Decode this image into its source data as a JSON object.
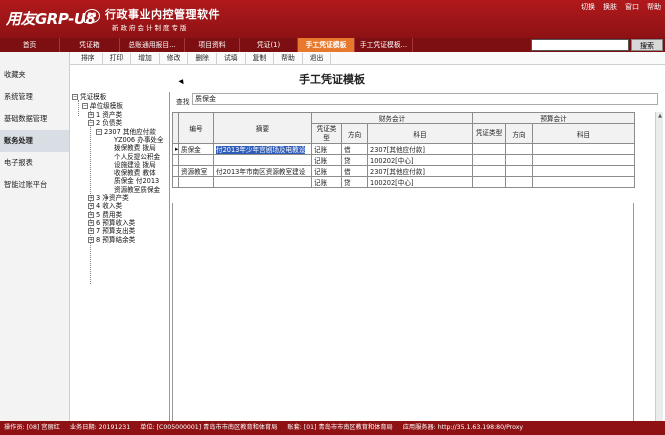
{
  "header": {
    "logo_text": "用友GRP-U8",
    "logo_badge": "R8",
    "app_title": "行政事业内控管理软件",
    "app_subtitle": "新政府会计制度专版",
    "links": [
      "切换",
      "换肤",
      "窗口",
      "帮助"
    ]
  },
  "tabs": [
    {
      "label": "首页",
      "active": false
    },
    {
      "label": "凭证箱",
      "active": false
    },
    {
      "label": "总账通用报目...",
      "active": false
    },
    {
      "label": "项目资料",
      "active": false
    },
    {
      "label": "凭证(1)",
      "active": false
    },
    {
      "label": "手工凭证模板",
      "active": true
    },
    {
      "label": "手工凭证模板...",
      "active": false
    }
  ],
  "search": {
    "button_label": "搜索",
    "value": ""
  },
  "sidebar": {
    "items": [
      {
        "label": "收藏夹",
        "active": false
      },
      {
        "label": "系统管理",
        "active": false
      },
      {
        "label": "基础数据管理",
        "active": false
      },
      {
        "label": "账务处理",
        "active": true
      },
      {
        "label": "电子报表",
        "active": false
      },
      {
        "label": "智能过账平台",
        "active": false
      }
    ]
  },
  "toolbar": [
    "排序",
    "打印",
    "增加",
    "修改",
    "删除",
    "试填",
    "复制",
    "帮助",
    "退出"
  ],
  "page_title": "手工凭证模板",
  "tree": {
    "root": "凭证模板",
    "unit": "单位级模板",
    "nodes": [
      {
        "text": "1 资产类",
        "level": 2,
        "expander": "+"
      },
      {
        "text": "2 负债类",
        "level": 2,
        "expander": "−"
      },
      {
        "text": "2307 其他应付款",
        "level": 3,
        "expander": "−"
      },
      {
        "text": "YZ006 办事处全",
        "level": 4,
        "expander": ""
      },
      {
        "text": "拨保教费 拨局",
        "level": 4,
        "expander": ""
      },
      {
        "text": "个人反提公积金",
        "level": 4,
        "expander": ""
      },
      {
        "text": "设施建设 拨局",
        "level": 4,
        "expander": ""
      },
      {
        "text": "收保教费 教体",
        "level": 4,
        "expander": ""
      },
      {
        "text": "质保金 付2013",
        "level": 4,
        "expander": ""
      },
      {
        "text": "资源教室质保金",
        "level": 4,
        "expander": ""
      },
      {
        "text": "3 净资产类",
        "level": 2,
        "expander": "+"
      },
      {
        "text": "4 收入类",
        "level": 2,
        "expander": "+"
      },
      {
        "text": "5 费用类",
        "level": 2,
        "expander": "+"
      },
      {
        "text": "6 预算收入类",
        "level": 2,
        "expander": "+"
      },
      {
        "text": "7 预算支出类",
        "level": 2,
        "expander": "+"
      },
      {
        "text": "8 预算结余类",
        "level": 2,
        "expander": "+"
      }
    ]
  },
  "filter": {
    "label": "查找",
    "value": "质保金"
  },
  "grid": {
    "group_financial": "财务会计",
    "group_budget": "预算会计",
    "col_no": "编号",
    "col_summary": "摘要",
    "col_vtype": "凭证类型",
    "col_dir": "方向",
    "col_subject": "科目",
    "rows": [
      {
        "no": "质保金",
        "summary": "付2013年少年宫剧场及电教设",
        "vtype": "记账",
        "dir": "借",
        "subject": "2307[其他应付款]",
        "selected": true
      },
      {
        "no": "",
        "summary": "",
        "vtype": "记账",
        "dir": "贷",
        "subject": "100202[中心]",
        "selected": false
      },
      {
        "no": "资源教室",
        "summary": "付2013年市南区资源教室建设",
        "vtype": "记账",
        "dir": "借",
        "subject": "2307[其他应付款]",
        "selected": false
      },
      {
        "no": "",
        "summary": "",
        "vtype": "记账",
        "dir": "贷",
        "subject": "100202[中心]",
        "selected": false
      }
    ]
  },
  "status": {
    "operator": "操作员: [08] 宫丽红",
    "biz_date": "业务日期: 20191231",
    "unit": "单位: [C005000001] 青岛市市南区教育和体育局",
    "account": "账套: [01] 青岛市市南区教育和体育局",
    "server": "应用服务器: http://35.1.63.198:80/Proxy"
  }
}
